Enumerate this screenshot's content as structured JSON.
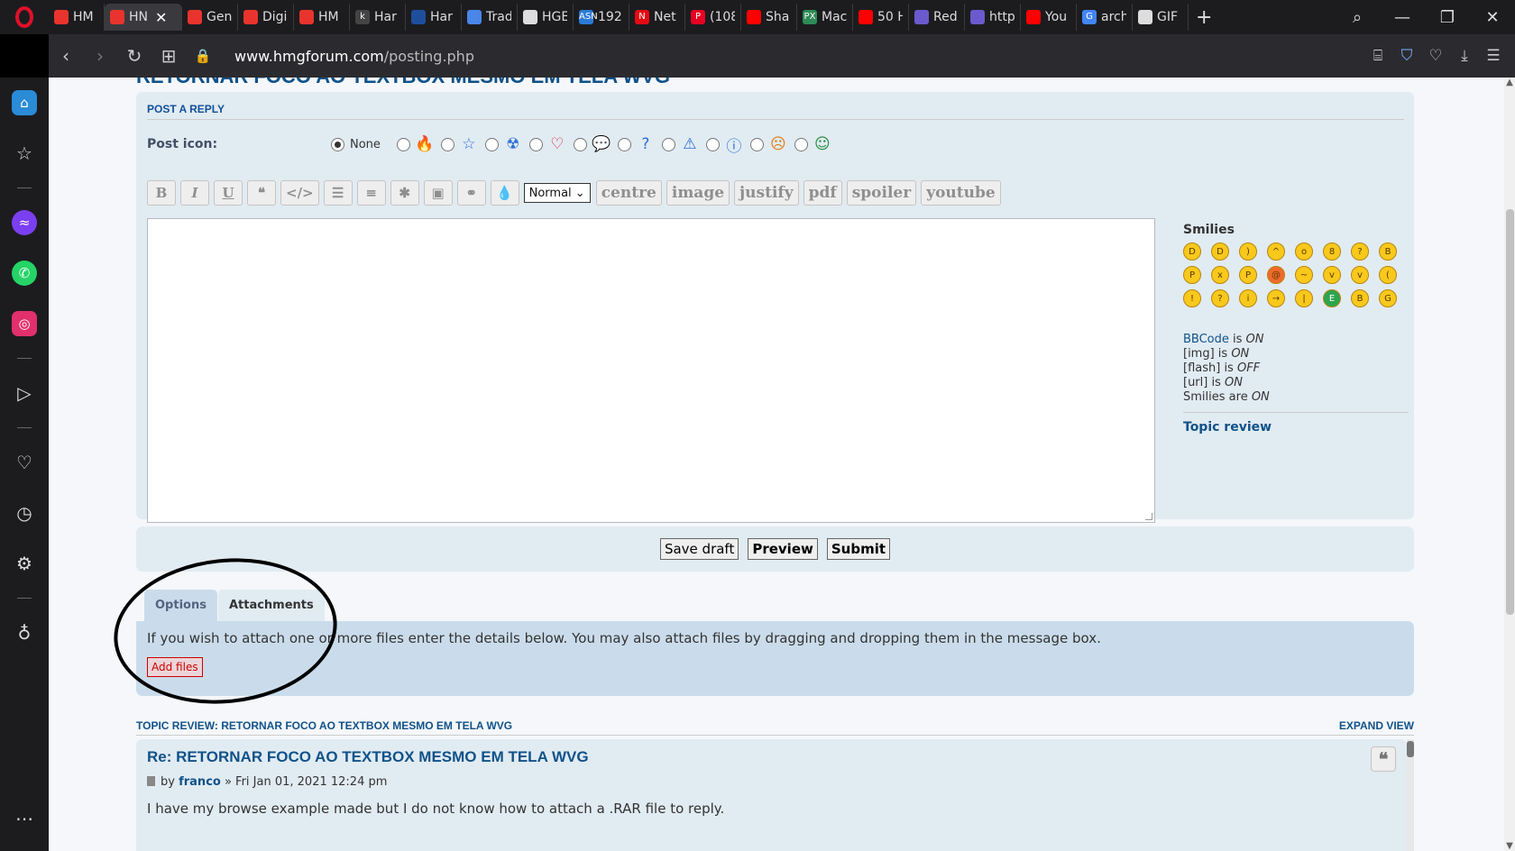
{
  "browser": {
    "tabs": [
      {
        "title": "HM",
        "color": "#e8342c"
      },
      {
        "title": "HN",
        "color": "#e8342c",
        "active": true
      },
      {
        "title": "Gen",
        "color": "#e8342c"
      },
      {
        "title": "Digi",
        "color": "#e8342c"
      },
      {
        "title": "HM",
        "color": "#e8342c"
      },
      {
        "title": "Har",
        "color": "#444444",
        "glyph": "k"
      },
      {
        "title": "Har",
        "color": "#1d4f9c"
      },
      {
        "title": "Trad",
        "color": "#4a86e8"
      },
      {
        "title": "HGE",
        "color": "#dddddd"
      },
      {
        "title": "192",
        "color": "#2a7bd6",
        "glyph": "ASN"
      },
      {
        "title": "Net",
        "color": "#e50914",
        "glyph": "N"
      },
      {
        "title": "(108",
        "color": "#e60023",
        "glyph": "P"
      },
      {
        "title": "Sha",
        "color": "#ff0000"
      },
      {
        "title": "Mac",
        "color": "#2e8b57",
        "glyph": "PX"
      },
      {
        "title": "50 H",
        "color": "#ff0000"
      },
      {
        "title": "Red",
        "color": "#6a5acd"
      },
      {
        "title": "http",
        "color": "#6a5acd"
      },
      {
        "title": "You",
        "color": "#ff0000"
      },
      {
        "title": "arch",
        "color": "#4285f4",
        "glyph": "G"
      },
      {
        "title": "GIF",
        "color": "#dddddd"
      }
    ],
    "url_domain": "www.hmgforum.com",
    "url_path": "/posting.php"
  },
  "page": {
    "topic_title": "RETORNAR FOCO AO TEXTBOX MESMO EM TELA WVG",
    "post_a_reply": "POST A REPLY",
    "post_icon_label": "Post icon:",
    "post_icon_none": "None",
    "post_icons": [
      "fire-icon",
      "star-icon",
      "radioactive-icon",
      "heart-icon",
      "speech-bubble-icon",
      "question-icon",
      "warning-icon",
      "info-icon",
      "smiley-angry-icon",
      "smiley-green-icon"
    ],
    "toolbar_buttons": [
      "B",
      "I",
      "U",
      "❝",
      "</>",
      "☰",
      "≡",
      "✱",
      "▣",
      "⚭",
      "💧"
    ],
    "font_size_select": "Normal",
    "custom_buttons": [
      "centre",
      "image",
      "justify",
      "pdf",
      "spoiler",
      "youtube"
    ],
    "smilies_title": "Smilies",
    "smilies": [
      {
        "face": "D",
        "tone": "yellow"
      },
      {
        "face": "D",
        "tone": "yellow"
      },
      {
        "face": ")",
        "tone": "yellow"
      },
      {
        "face": "^",
        "tone": "yellow"
      },
      {
        "face": "o",
        "tone": "yellow"
      },
      {
        "face": "8",
        "tone": "yellow"
      },
      {
        "face": "?",
        "tone": "yellow"
      },
      {
        "face": "B",
        "tone": "yellow"
      },
      {
        "face": "P",
        "tone": "yellow"
      },
      {
        "face": "x",
        "tone": "yellow"
      },
      {
        "face": "P",
        "tone": "yellow"
      },
      {
        "face": "@",
        "tone": "red"
      },
      {
        "face": "~",
        "tone": "yellow"
      },
      {
        "face": "v",
        "tone": "yellow"
      },
      {
        "face": "v",
        "tone": "yellow"
      },
      {
        "face": "(",
        "tone": "yellow"
      },
      {
        "face": "!",
        "tone": "yellow"
      },
      {
        "face": "?",
        "tone": "yellow"
      },
      {
        "face": "i",
        "tone": "yellow"
      },
      {
        "face": "→",
        "tone": "yellow"
      },
      {
        "face": "|",
        "tone": "yellow"
      },
      {
        "face": "E",
        "tone": "green"
      },
      {
        "face": "B",
        "tone": "yellow"
      },
      {
        "face": "G",
        "tone": "yellow"
      }
    ],
    "bbcode": [
      {
        "key": "BBCode",
        "word": " is ",
        "state": "ON"
      },
      {
        "key": "[img]",
        "word": " is ",
        "state": "ON"
      },
      {
        "key": "[flash]",
        "word": " is ",
        "state": "OFF"
      },
      {
        "key": "[url]",
        "word": " is ",
        "state": "ON"
      },
      {
        "key": "Smilies",
        "word": " are ",
        "state": "ON"
      }
    ],
    "topic_review_link": "Topic review",
    "save_draft": "Save draft",
    "preview": "Preview",
    "submit": "Submit",
    "tab_options": "Options",
    "tab_attachments": "Attachments",
    "attach_text": "If you wish to attach one or more files enter the details below. You may also attach files by dragging and dropping them in the message box.",
    "add_files": "Add files",
    "topic_review_heading": "TOPIC REVIEW: RETORNAR FOCO AO TEXTBOX MESMO EM TELA WVG",
    "expand_view": "EXPAND VIEW",
    "post": {
      "title": "Re: RETORNAR FOCO AO TEXTBOX MESMO EM TELA WVG",
      "by": "by",
      "author": "franco",
      "date": "» Fri Jan 01, 2021 12:24 pm",
      "body": "I have my browse example made but I do not know how to attach a .RAR file to reply."
    }
  },
  "colors": {
    "link": "#105289",
    "panel": "#e1ebf2",
    "attach_panel": "#cadceb",
    "opera_red": "#e0102b"
  }
}
